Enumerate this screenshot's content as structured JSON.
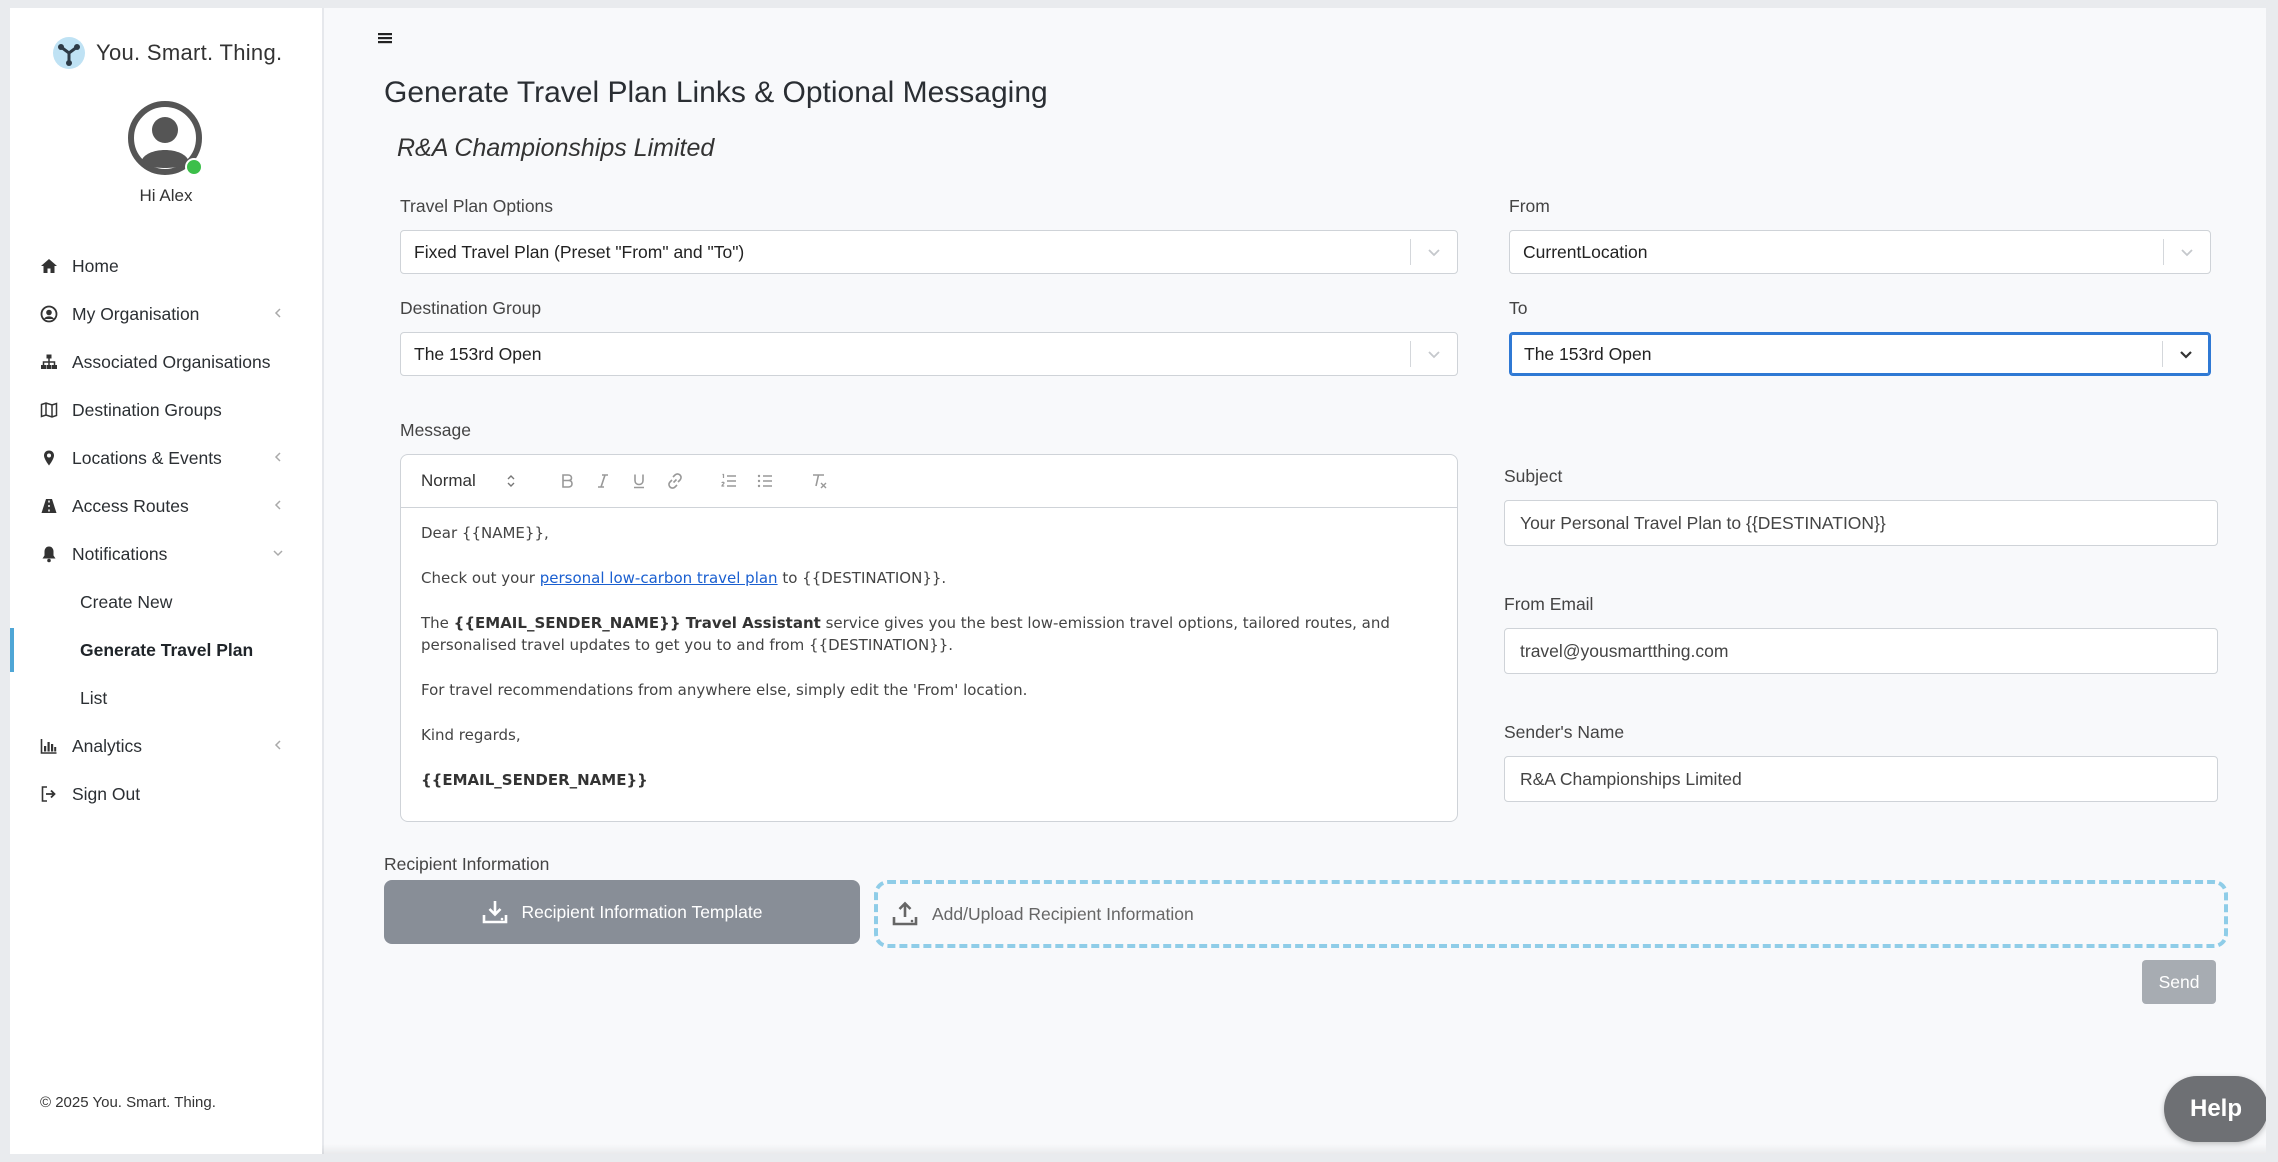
{
  "brand": {
    "name": "You. Smart. Thing."
  },
  "user": {
    "greeting": "Hi Alex"
  },
  "sidebar": {
    "items": [
      {
        "label": "Home",
        "icon": "home-icon"
      },
      {
        "label": "My Organisation",
        "icon": "user-circle-icon",
        "expandable": true
      },
      {
        "label": "Associated Organisations",
        "icon": "sitemap-icon"
      },
      {
        "label": "Destination Groups",
        "icon": "map-icon"
      },
      {
        "label": "Locations & Events",
        "icon": "map-pin-icon",
        "expandable": true
      },
      {
        "label": "Access Routes",
        "icon": "road-icon",
        "expandable": true
      },
      {
        "label": "Notifications",
        "icon": "bell-icon",
        "expanded": true
      },
      {
        "label": "Create New",
        "sub": true
      },
      {
        "label": "Generate Travel Plan",
        "sub": true,
        "active": true
      },
      {
        "label": "List",
        "sub": true
      },
      {
        "label": "Analytics",
        "icon": "bar-chart-icon",
        "expandable": true
      },
      {
        "label": "Sign Out",
        "icon": "sign-out-icon"
      }
    ],
    "accent_color": "#4fa6d6"
  },
  "footer": {
    "copyright": "© 2025 You. Smart. Thing."
  },
  "page": {
    "title": "Generate Travel Plan Links & Optional Messaging",
    "org_name": "R&A Championships Limited"
  },
  "form": {
    "travel_plan_options": {
      "label": "Travel Plan Options",
      "value": "Fixed Travel Plan (Preset \"From\" and \"To\")"
    },
    "from": {
      "label": "From",
      "value": "CurrentLocation"
    },
    "destination_group": {
      "label": "Destination Group",
      "value": "The 153rd Open"
    },
    "to": {
      "label": "To",
      "value": "The 153rd Open"
    },
    "message": {
      "label": "Message",
      "format": "Normal",
      "greeting": "Dear {{NAME}},",
      "line1_pre": "Check out your ",
      "line1_link": "personal low-carbon travel plan",
      "line1_post": " to {{DESTINATION}}.",
      "line2_pre": "The ",
      "line2_bold": "{{EMAIL_SENDER_NAME}} Travel Assistant",
      "line2_post": " service gives you the best low-emission travel options, tailored routes, and personalised travel updates to get you to and from {{DESTINATION}}.",
      "line3": "For travel recommendations from anywhere else, simply edit the 'From' location.",
      "closing": "Kind regards,",
      "signature": "{{EMAIL_SENDER_NAME}}"
    },
    "subject": {
      "label": "Subject",
      "value": "Your Personal Travel Plan to {{DESTINATION}}"
    },
    "from_email": {
      "label": "From Email",
      "value": "travel@yousmartthing.com"
    },
    "sender_name": {
      "label": "Sender's Name",
      "value": "R&A Championships Limited"
    }
  },
  "recipients": {
    "label": "Recipient Information",
    "template_button": "Recipient Information Template",
    "upload_label": "Add/Upload Recipient Information"
  },
  "actions": {
    "send": "Send",
    "help": "Help"
  }
}
